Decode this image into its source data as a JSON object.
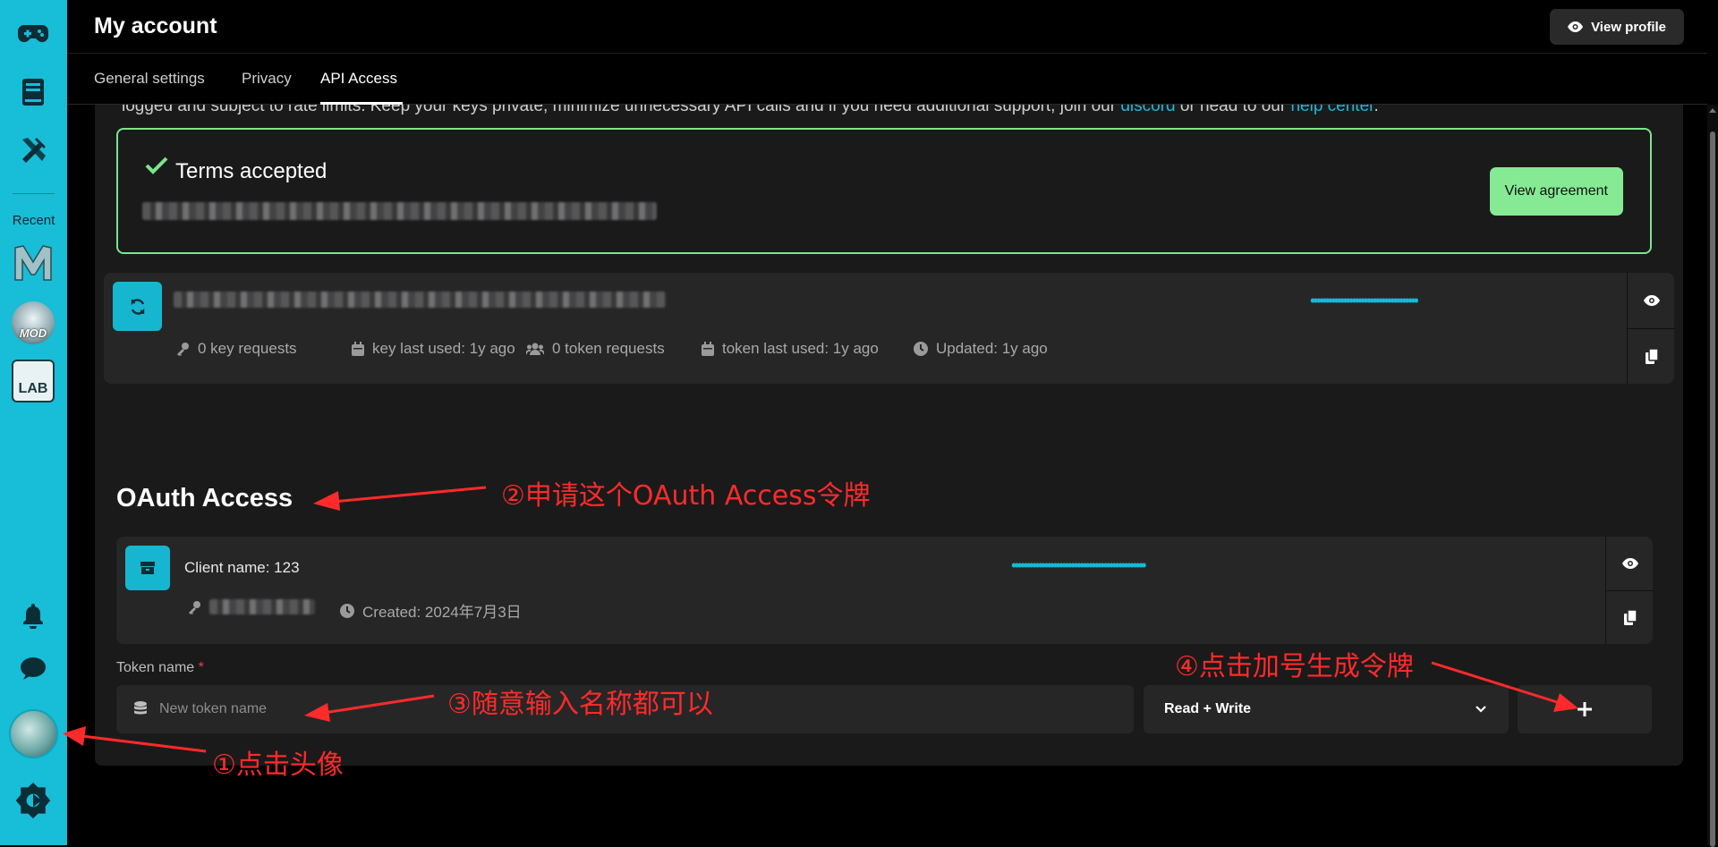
{
  "sidebar": {
    "recent_label": "Recent",
    "items": [
      {
        "icon": "gamepad-icon"
      },
      {
        "icon": "book-icon"
      },
      {
        "icon": "tools-icon"
      }
    ],
    "recent": [
      {
        "icon": "mod-m-thumbnail"
      },
      {
        "icon": "mod-disc-thumbnail",
        "text": "MOD"
      },
      {
        "icon": "lab-thumbnail",
        "text": "LAB"
      }
    ],
    "bottom": [
      {
        "icon": "bell-icon"
      },
      {
        "icon": "chat-icon"
      },
      {
        "icon": "avatar"
      },
      {
        "icon": "gear-logo-icon"
      }
    ]
  },
  "header": {
    "title": "My account",
    "view_profile": "View profile"
  },
  "tabs": [
    {
      "label": "General settings",
      "active": false
    },
    {
      "label": "Privacy",
      "active": false
    },
    {
      "label": "API Access",
      "active": true
    }
  ],
  "api": {
    "intro_text": "logged and subject to rate limits. Keep your keys private, minimize unnecessary API calls and if you need additional support, join our",
    "intro_link1": "discord",
    "intro_mid": "or head to our",
    "intro_link2": "help center",
    "intro_end": ".",
    "terms_title": "Terms accepted",
    "view_agreement": "View agreement",
    "key": {
      "masked": "••••••••••••••••••••••••••••••••••••",
      "key_requests": "0 key requests",
      "key_last_used": "key last used: 1y ago",
      "token_requests": "0 token requests",
      "token_last_used": "token last used: 1y ago",
      "updated": "Updated: 1y ago"
    }
  },
  "oauth": {
    "title": "OAuth Access",
    "client_name": "Client name: 123",
    "masked": "•••••••••••••••••••••••••••••••••••••••••••••",
    "created": "Created: 2024年7月3日",
    "token_label": "Token name",
    "required_mark": "*",
    "token_placeholder": "New token name",
    "scope": "Read + Write",
    "add_symbol": "+"
  },
  "annotations": {
    "step1": "①点击头像",
    "step2": "②申请这个OAuth Access令牌",
    "step3": "③随意输入名称都可以",
    "step4": "④点击加号生成令牌"
  },
  "colors": {
    "sidebar": "#18bdd7",
    "accent": "#16b6d0",
    "success": "#86ea95",
    "annotation": "#ff2a2a"
  }
}
